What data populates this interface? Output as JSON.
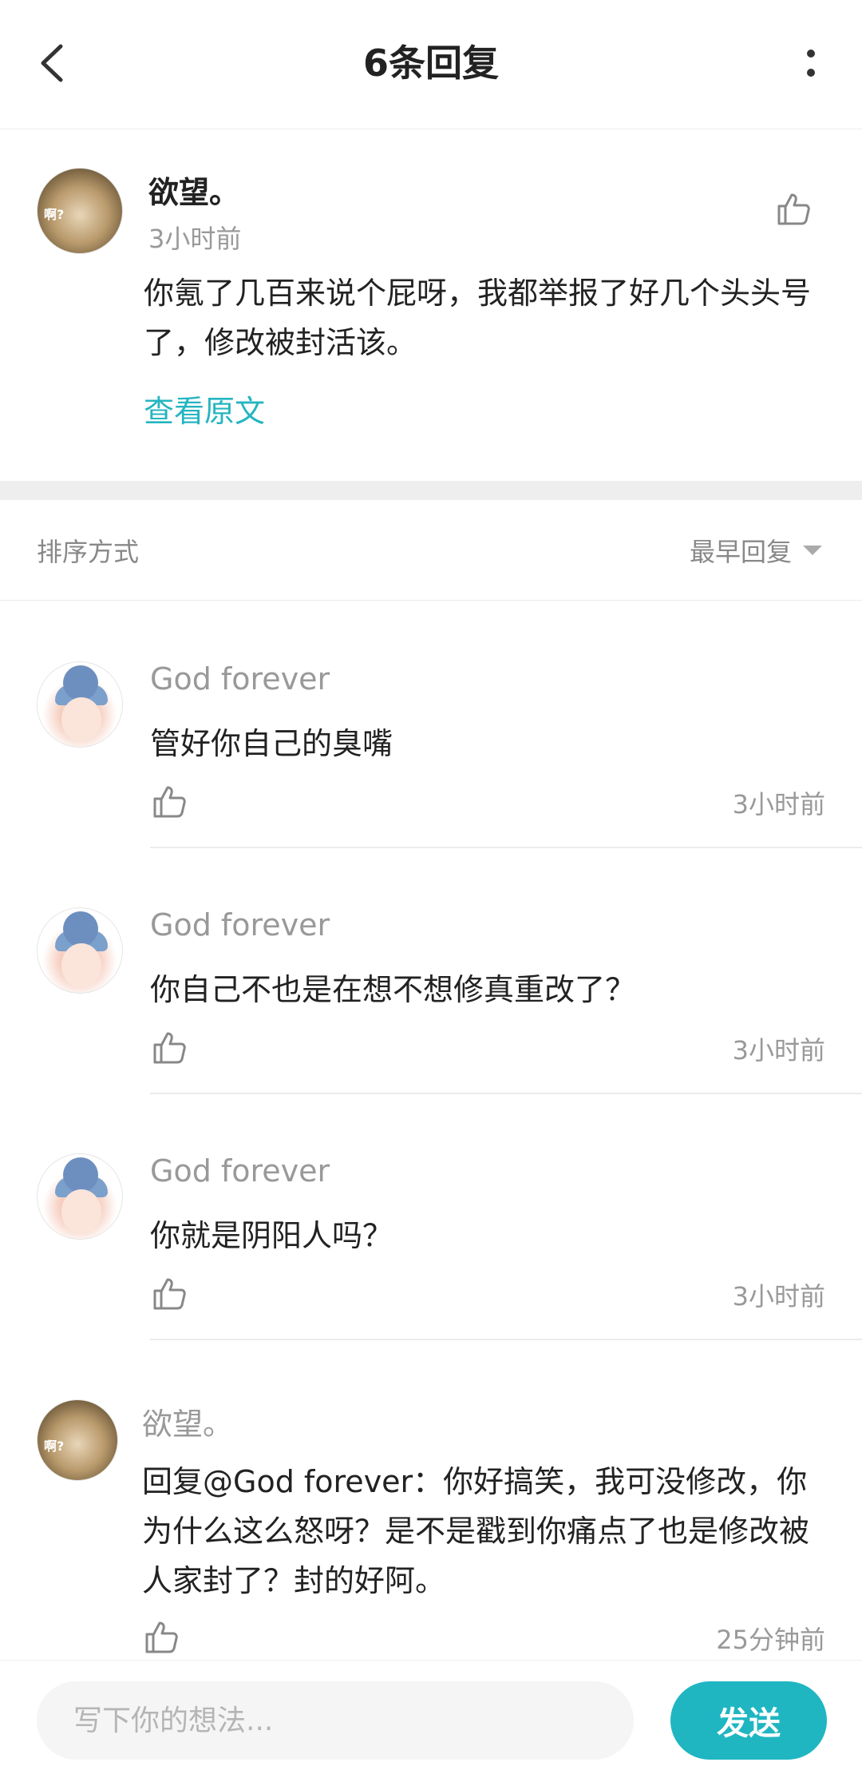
{
  "header": {
    "title": "6条回复"
  },
  "original_comment": {
    "author": "欲望。",
    "time": "3小时前",
    "content": "你氪了几百来说个屁呀，我都举报了好几个头头号了，修改被封活该。",
    "view_original_label": "查看原文",
    "avatar_text": "啊?"
  },
  "sort": {
    "label": "排序方式",
    "selected": "最早回复"
  },
  "replies": [
    {
      "author": "God forever",
      "content": "管好你自己的臭嘴",
      "time": "3小时前"
    },
    {
      "author": "God forever",
      "content": "你自己不也是在想不想修真重改了？",
      "time": "3小时前"
    },
    {
      "author": "God forever",
      "content": "你就是阴阳人吗？",
      "time": "3小时前"
    },
    {
      "author": "欲望。",
      "content": "回复@God forever：你好搞笑，我可没修改，你为什么这么怒呀？是不是戳到你痛点了也是修改被人家封了？封的好阿。",
      "time": "25分钟前",
      "avatar_text": "啊?"
    }
  ],
  "input_bar": {
    "placeholder": "写下你的想法...",
    "send_label": "发送"
  },
  "colors": {
    "accent": "#1fb6c2",
    "link": "#24b5c0",
    "muted_text": "#999999",
    "divider": "#eeeeee"
  }
}
